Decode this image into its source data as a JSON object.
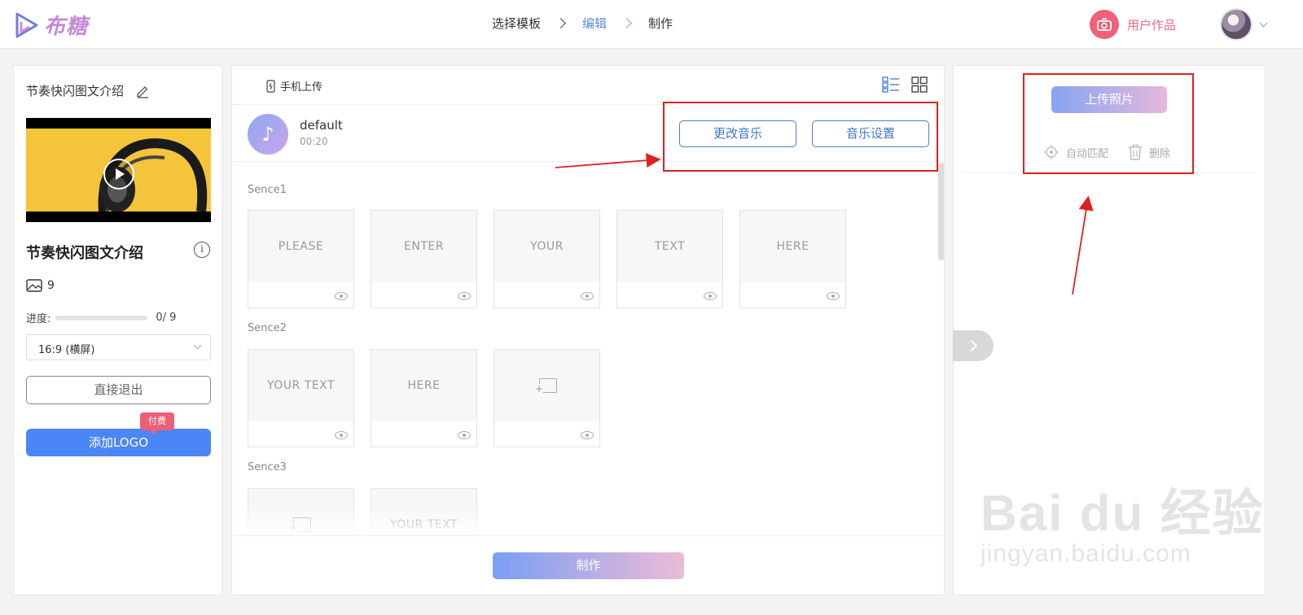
{
  "header": {
    "logo_text": "布糖",
    "steps": [
      "选择模板",
      "编辑",
      "制作"
    ],
    "user_works_label": "用户作品"
  },
  "left": {
    "project_title": "节奏快闪图文介绍",
    "project_name": "节奏快闪图文介绍",
    "image_count": "9",
    "progress_label": "进度:",
    "progress_value": 0,
    "progress_text": "0/ 9",
    "ratio_selected": "16:9 (横屏)",
    "exit_label": "直接退出",
    "add_logo_label": "添加LOGO",
    "paid_badge": "付费"
  },
  "center": {
    "phone_upload_label": "手机上传",
    "music": {
      "name": "default",
      "duration": "00:20",
      "change_label": "更改音乐",
      "settings_label": "音乐设置"
    },
    "scenes": [
      {
        "label": "Sence1",
        "cards": [
          {
            "text": "PLEASE"
          },
          {
            "text": "ENTER"
          },
          {
            "text": "YOUR"
          },
          {
            "text": "TEXT"
          },
          {
            "text": "HERE"
          }
        ]
      },
      {
        "label": "Sence2",
        "cards": [
          {
            "text": "YOUR TEXT"
          },
          {
            "text": "HERE"
          },
          {
            "text": ""
          }
        ]
      },
      {
        "label": "Sence3",
        "cards": [
          {
            "text": ""
          },
          {
            "text": "YOUR TEXT"
          }
        ]
      }
    ],
    "make_label": "制作"
  },
  "right": {
    "upload_label": "上传照片",
    "auto_match_label": "自动匹配",
    "delete_label": "删除"
  },
  "watermark": {
    "main": "Bai du 经验",
    "sub": "jingyan.baidu.com"
  },
  "colors": {
    "accent_blue": "#4a86f5",
    "pink": "#ec5f79",
    "annotation_red": "#e02020"
  }
}
